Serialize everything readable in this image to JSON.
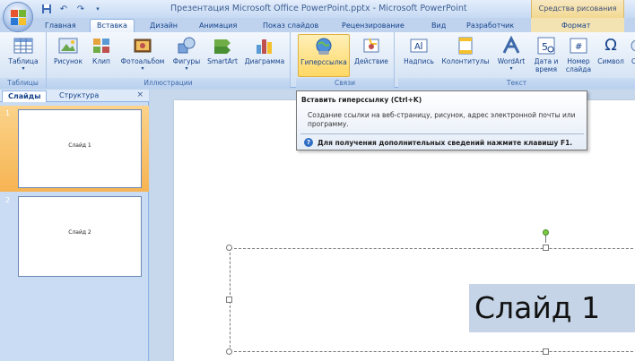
{
  "window": {
    "title": "Презентация Microsoft Office PowerPoint.pptx - Microsoft PowerPoint",
    "context_header": "Средства рисования"
  },
  "tabs": [
    {
      "label": "Главная"
    },
    {
      "label": "Вставка",
      "active": true
    },
    {
      "label": "Дизайн"
    },
    {
      "label": "Анимация"
    },
    {
      "label": "Показ слайдов"
    },
    {
      "label": "Рецензирование"
    },
    {
      "label": "Вид"
    },
    {
      "label": "Разработчик"
    },
    {
      "label": "Формат",
      "contextual": true
    }
  ],
  "ribbon": {
    "groups": {
      "tables": {
        "label": "Таблицы"
      },
      "illustrations": {
        "label": "Иллюстрации"
      },
      "links": {
        "label": "Связи"
      },
      "text": {
        "label": "Текст"
      }
    },
    "buttons": {
      "table": "Таблица",
      "picture": "Рисунок",
      "clip": "Клип",
      "photo_album": "Фотоальбом",
      "shapes": "Фигуры",
      "smartart": "SmartArt",
      "chart": "Диаграмма",
      "hyperlink": "Гиперссылка",
      "action": "Действие",
      "textbox": "Надпись",
      "header_footer": "Колонтитулы",
      "wordart": "WordArt",
      "date_time_1": "Дата и",
      "date_time_2": "время",
      "slide_number_1": "Номер",
      "slide_number_2": "слайда",
      "symbol": "Символ",
      "symbol_glyph": "Ω",
      "object_partial": "О",
      "date_icon_text": "5",
      "number_icon_text": "#",
      "textbox_icon_text": "A"
    }
  },
  "leftpane": {
    "tabs": {
      "slides": "Слайды",
      "outline": "Структура"
    },
    "close": "×",
    "thumbnails": [
      {
        "number": "1",
        "title": "Слайд 1",
        "selected": true
      },
      {
        "number": "2",
        "title": "Слайд 2",
        "selected": false
      }
    ]
  },
  "slide": {
    "title_text": "Слайд 1"
  },
  "tooltip": {
    "title": "Вставить гиперссылку (Ctrl+K)",
    "description": "Создание ссылки на веб-страницу, рисунок, адрес электронной почты или программу.",
    "help": "Для получения дополнительных сведений нажмите клавишу F1.",
    "help_icon": "?"
  },
  "colors": {
    "ribbon_accent": "#15428b",
    "selected_thumb": "#f7b453",
    "highlight_button": "#ffd865"
  }
}
